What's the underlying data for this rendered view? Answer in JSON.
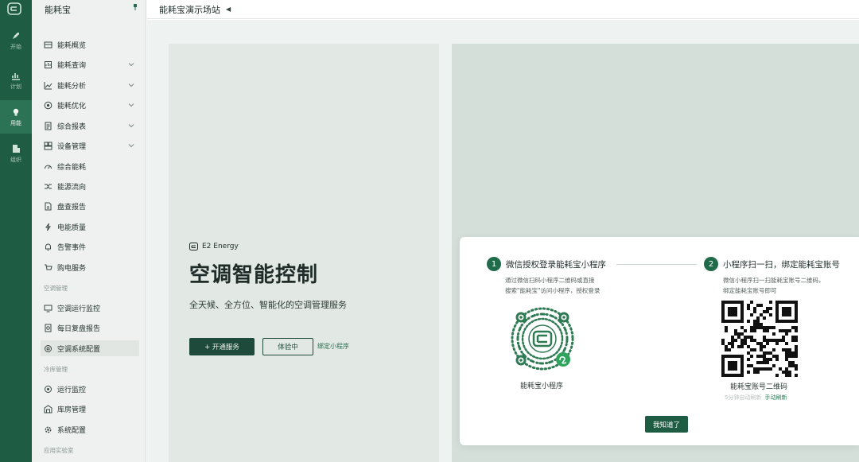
{
  "app": {
    "name": "能耗宝",
    "site": "能耗宝演示场站"
  },
  "rail": {
    "items": [
      {
        "label": "开始",
        "icon": "rocket-icon"
      },
      {
        "label": "计划",
        "icon": "chart-icon"
      },
      {
        "label": "用能",
        "icon": "bulb-icon"
      },
      {
        "label": "组织",
        "icon": "building-icon"
      }
    ]
  },
  "sidebar": {
    "items": [
      {
        "label": "能耗概览",
        "icon": "overview-icon"
      },
      {
        "label": "能耗查询",
        "icon": "query-icon"
      },
      {
        "label": "能耗分析",
        "icon": "analysis-icon"
      },
      {
        "label": "能耗优化",
        "icon": "optimize-icon"
      },
      {
        "label": "综合报表",
        "icon": "report-icon"
      },
      {
        "label": "设备管理",
        "icon": "device-icon"
      },
      {
        "label": "综合能耗",
        "icon": "gauge-icon"
      },
      {
        "label": "能源流向",
        "icon": "flow-icon"
      },
      {
        "label": "盘查报告",
        "icon": "doc-icon"
      },
      {
        "label": "电能质量",
        "icon": "bolt-icon"
      },
      {
        "label": "告警事件",
        "icon": "bell-icon"
      },
      {
        "label": "购电服务",
        "icon": "cart-icon"
      }
    ],
    "group_ac": "空调管理",
    "ac_items": [
      {
        "label": "空调运行监控",
        "icon": "monitor-icon"
      },
      {
        "label": "每日复盘报告",
        "icon": "daily-report-icon"
      },
      {
        "label": "空调系统配置",
        "icon": "settings-icon"
      }
    ],
    "group_store": "冷库管理",
    "store_items": [
      {
        "label": "运行监控",
        "icon": "location-icon"
      },
      {
        "label": "库房管理",
        "icon": "storage-icon"
      },
      {
        "label": "系统配置",
        "icon": "gear-icon"
      }
    ],
    "group_lab": "应用实验室"
  },
  "hero": {
    "brand": "E2 Energy",
    "title": "空调智能控制",
    "subtitle": "全天候、全方位、智能化的空调管理服务",
    "primary_button": "+ 开通服务",
    "secondary_button": "体验中",
    "link": "绑定小程序"
  },
  "modal": {
    "step1": {
      "num": "1",
      "title": "微信授权登录能耗宝小程序",
      "desc1": "通过微信扫码小程序二维码或直接",
      "desc2": "搜索\"能耗宝\"访问小程序，授权登录",
      "caption": "能耗宝小程序"
    },
    "step2": {
      "num": "2",
      "title": "小程序扫一扫，绑定能耗宝账号",
      "desc1": "微信小程序扫一扫能耗宝账号二维码，",
      "desc2": "绑定能耗宝账号即可",
      "caption": "能耗宝账号二维码",
      "refresh_text": "5分钟自动刷新",
      "refresh_link": "手动刷新"
    },
    "confirm_button": "我知道了"
  },
  "colors": {
    "rail": "#1f5c44",
    "accent": "#1f6b4a",
    "sidebar": "#eef1ef"
  }
}
